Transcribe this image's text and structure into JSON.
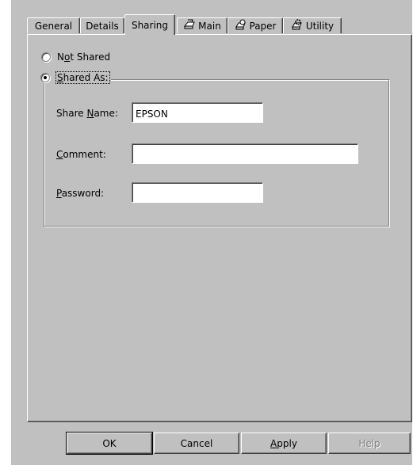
{
  "tabs": [
    {
      "label": "General",
      "icon": null
    },
    {
      "label": "Details",
      "icon": null
    },
    {
      "label": "Sharing",
      "icon": null,
      "selected": true
    },
    {
      "label": "Main",
      "icon": "printer-icon"
    },
    {
      "label": "Paper",
      "icon": "paper-icon"
    },
    {
      "label": "Utility",
      "icon": "utility-icon"
    }
  ],
  "sharing": {
    "not_shared": {
      "pre": "N",
      "accel": "o",
      "post": "t Shared",
      "checked": false
    },
    "shared_as": {
      "pre": "",
      "accel": "S",
      "post": "hared As:",
      "checked": true
    },
    "share_name": {
      "pre": "Share ",
      "accel": "N",
      "post": "ame:",
      "value": "EPSON"
    },
    "comment": {
      "pre": "",
      "accel": "C",
      "post": "omment:",
      "value": ""
    },
    "password": {
      "pre": "",
      "accel": "P",
      "post": "assword:",
      "value": ""
    }
  },
  "buttons": {
    "ok": {
      "label": "OK"
    },
    "cancel": {
      "label": "Cancel"
    },
    "apply": {
      "pre": "",
      "accel": "A",
      "post": "pply"
    },
    "help": {
      "label": "Help",
      "disabled": true
    }
  }
}
